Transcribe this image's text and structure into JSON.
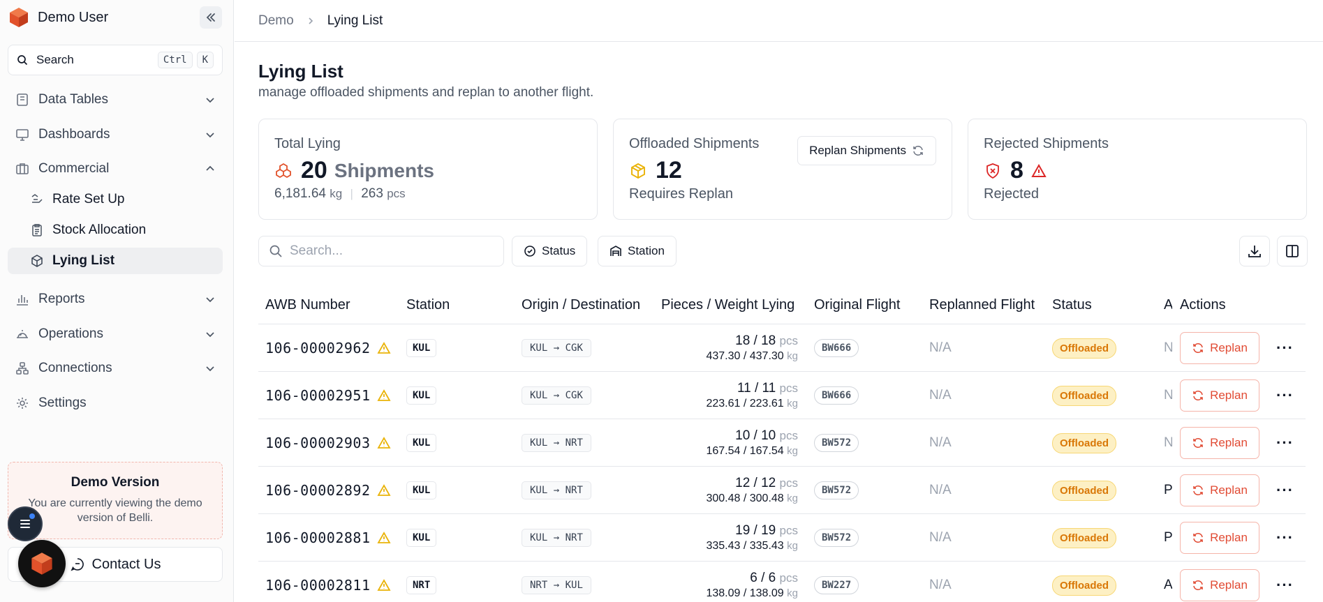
{
  "sidebar": {
    "user_name": "Demo User",
    "search_label": "Search",
    "shortcut_ctrl": "Ctrl",
    "shortcut_k": "K",
    "nav": {
      "data_tables": "Data Tables",
      "dashboards": "Dashboards",
      "commercial": "Commercial",
      "rate_set_up": "Rate Set Up",
      "stock_allocation": "Stock Allocation",
      "lying_list": "Lying List",
      "reports": "Reports",
      "operations": "Operations",
      "connections": "Connections",
      "settings": "Settings"
    },
    "demo_title": "Demo Version",
    "demo_text": "You are currently viewing the demo version of Belli.",
    "contact_label": "Contact Us"
  },
  "breadcrumb": {
    "parent": "Demo",
    "current": "Lying List"
  },
  "page": {
    "title": "Lying List",
    "subtitle": "manage offloaded shipments and replan to another flight."
  },
  "cards": {
    "total": {
      "title": "Total Lying",
      "value": "20",
      "unit": "Shipments",
      "weight": "6,181.64",
      "weight_unit": "kg",
      "pieces": "263",
      "pieces_unit": "pcs"
    },
    "offloaded": {
      "title": "Offloaded Shipments",
      "value": "12",
      "sub": "Requires Replan",
      "button": "Replan Shipments"
    },
    "rejected": {
      "title": "Rejected Shipments",
      "value": "8",
      "sub": "Rejected"
    }
  },
  "filters": {
    "search_placeholder": "Search...",
    "status_label": "Status",
    "station_label": "Station"
  },
  "table": {
    "headers": {
      "awb": "AWB Number",
      "station": "Station",
      "od": "Origin / Destination",
      "pw": "Pieces / Weight Lying",
      "orig_flight": "Original Flight",
      "replanned": "Replanned Flight",
      "status": "Status",
      "trunc": "A",
      "actions": "Actions"
    },
    "units": {
      "pcs": "pcs",
      "kg": "kg"
    },
    "replan_label": "Replan",
    "more_label": "···",
    "rows": [
      {
        "awb": "106-00002962",
        "station": "KUL",
        "origin": "KUL",
        "dest": "CGK",
        "pieces": "18 / 18",
        "weight": "437.30 / 437.30",
        "flight": "BW666",
        "replanned": "N/A",
        "status": "Offloaded",
        "trunc": "N"
      },
      {
        "awb": "106-00002951",
        "station": "KUL",
        "origin": "KUL",
        "dest": "CGK",
        "pieces": "11 / 11",
        "weight": "223.61 / 223.61",
        "flight": "BW666",
        "replanned": "N/A",
        "status": "Offloaded",
        "trunc": "N"
      },
      {
        "awb": "106-00002903",
        "station": "KUL",
        "origin": "KUL",
        "dest": "NRT",
        "pieces": "10 / 10",
        "weight": "167.54 / 167.54",
        "flight": "BW572",
        "replanned": "N/A",
        "status": "Offloaded",
        "trunc": "N"
      },
      {
        "awb": "106-00002892",
        "station": "KUL",
        "origin": "KUL",
        "dest": "NRT",
        "pieces": "12 / 12",
        "weight": "300.48 / 300.48",
        "flight": "BW572",
        "replanned": "N/A",
        "status": "Offloaded",
        "trunc": "P"
      },
      {
        "awb": "106-00002881",
        "station": "KUL",
        "origin": "KUL",
        "dest": "NRT",
        "pieces": "19 / 19",
        "weight": "335.43 / 335.43",
        "flight": "BW572",
        "replanned": "N/A",
        "status": "Offloaded",
        "trunc": "P"
      },
      {
        "awb": "106-00002811",
        "station": "NRT",
        "origin": "NRT",
        "dest": "KUL",
        "pieces": "6 / 6",
        "weight": "138.09 / 138.09",
        "flight": "BW227",
        "replanned": "N/A",
        "status": "Offloaded",
        "trunc": "A"
      }
    ]
  },
  "colors": {
    "brand": "#e2522b",
    "warning": "#eab308",
    "danger": "#dc2626",
    "status_offloaded": "#d97706"
  },
  "icons": [
    "cube-logo-icon",
    "search-icon",
    "database-icon",
    "monitor-icon",
    "briefcase-icon",
    "clipboard-icon",
    "package-icon",
    "bar-chart-icon",
    "operations-icon",
    "network-icon",
    "gear-icon",
    "warning-icon",
    "refresh-icon",
    "download-icon",
    "columns-icon"
  ]
}
